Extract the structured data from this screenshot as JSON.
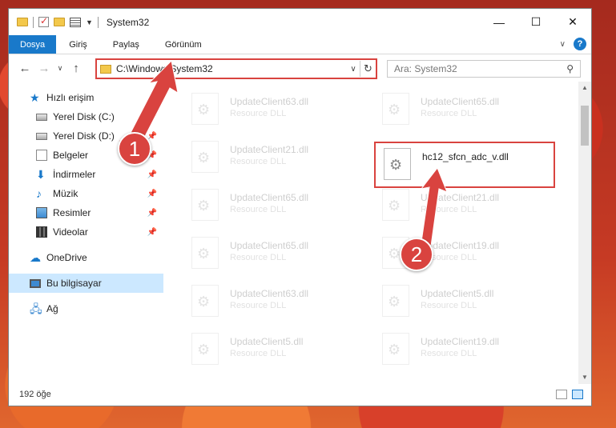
{
  "window": {
    "title": "System32",
    "controls": {
      "minimize": "—",
      "maximize": "☐",
      "close": "✕"
    }
  },
  "ribbon": {
    "tabs": [
      "Dosya",
      "Giriş",
      "Paylaş",
      "Görünüm"
    ],
    "help_label": "?"
  },
  "nav": {
    "address_path": "C:\\Windows\\System32",
    "search_placeholder": "Ara: System32"
  },
  "sidebar": {
    "items": [
      {
        "label": "Hızlı erişim",
        "icon": "star-icon"
      },
      {
        "label": "Yerel Disk (C:)",
        "icon": "drive-icon",
        "pinned": true
      },
      {
        "label": "Yerel Disk (D:)",
        "icon": "drive-icon",
        "pinned": true
      },
      {
        "label": "Belgeler",
        "icon": "documents-icon",
        "pinned": true
      },
      {
        "label": "İndirmeler",
        "icon": "download-icon",
        "pinned": true
      },
      {
        "label": "Müzik",
        "icon": "music-icon",
        "pinned": true
      },
      {
        "label": "Resimler",
        "icon": "pictures-icon",
        "pinned": true
      },
      {
        "label": "Videolar",
        "icon": "videos-icon",
        "pinned": true
      },
      {
        "label": "OneDrive",
        "icon": "cloud-icon"
      },
      {
        "label": "Bu bilgisayar",
        "icon": "pc-icon",
        "selected": true
      },
      {
        "label": "Ağ",
        "icon": "network-icon"
      }
    ]
  },
  "files": {
    "left_column": [
      {
        "name": "UpdateClient63.dll",
        "type": "Resource DLL"
      },
      {
        "name": "UpdateClient21.dll",
        "type": "Resource DLL"
      },
      {
        "name": "UpdateClient65.dll",
        "type": "Resource DLL"
      },
      {
        "name": "UpdateClient65.dll",
        "type": "Resource DLL"
      },
      {
        "name": "UpdateClient63.dll",
        "type": "Resource DLL"
      },
      {
        "name": "UpdateClient5.dll",
        "type": "Resource DLL"
      }
    ],
    "right_column": [
      {
        "name": "UpdateClient65.dll",
        "type": "Resource DLL"
      },
      {
        "name": "hc12_sfcn_adc_v.dll",
        "type": ""
      },
      {
        "name": "UpdateClient21.dll",
        "type": "Resource DLL"
      },
      {
        "name": "UpdateClient19.dll",
        "type": "Resource DLL"
      },
      {
        "name": "UpdateClient5.dll",
        "type": "Resource DLL"
      },
      {
        "name": "UpdateClient19.dll",
        "type": "Resource DLL"
      }
    ]
  },
  "status": {
    "item_count": "192 öğe"
  },
  "callouts": {
    "one": "1",
    "two": "2"
  },
  "colors": {
    "accent": "#1979ca",
    "highlight": "#d9433f"
  }
}
